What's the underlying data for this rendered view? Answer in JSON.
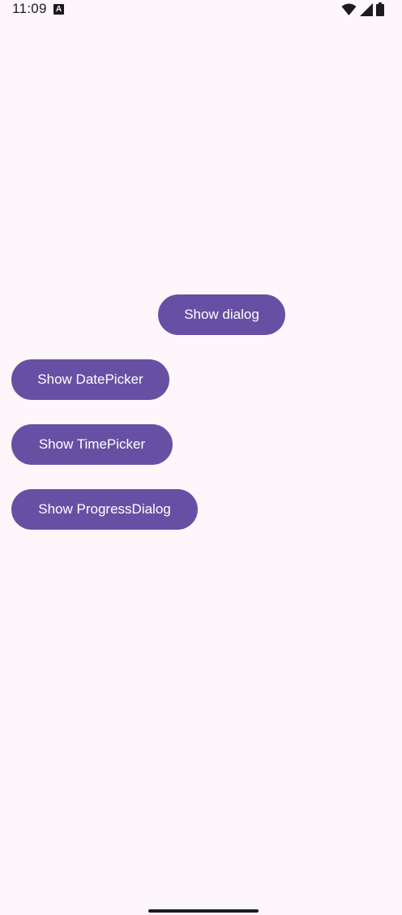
{
  "status_bar": {
    "time": "11:09",
    "notification_icon": "A",
    "icons": [
      "wifi-icon",
      "cellular-signal-icon",
      "battery-icon"
    ]
  },
  "buttons": {
    "show_dialog": "Show dialog",
    "show_date_picker": "Show DatePicker",
    "show_time_picker": "Show TimePicker",
    "show_progress_dialog": "Show ProgressDialog"
  },
  "colors": {
    "background": "#fdf7fc",
    "button": "#6750a4",
    "button_text": "#ffffff",
    "status_foreground": "#1c1b1f"
  }
}
